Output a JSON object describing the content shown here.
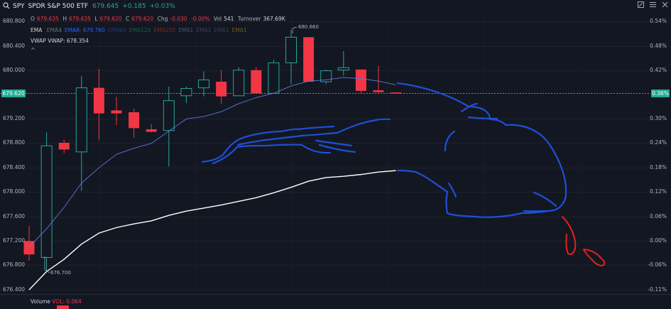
{
  "header": {
    "symbol": "SPY",
    "name": "SPDR S&P 500 ETF",
    "price": "679.645",
    "change": "+0.185",
    "change_pct": "+0.03%"
  },
  "ohlc": {
    "o_label": "O",
    "o": "679.635",
    "h_label": "H",
    "h": "679.635",
    "l_label": "L",
    "l": "679.620",
    "c_label": "C",
    "c": "679.620",
    "chg_label": "Chg",
    "chg": "-0.030",
    "chg_pct": "-0.00%",
    "vol_label": "Vol",
    "vol": "541",
    "turnover_label": "Turnover",
    "turnover": "367.69K"
  },
  "indicators": {
    "ema_title": "EMA",
    "ema_items": [
      {
        "label": "EMA4",
        "color": "#6b6f7a"
      },
      {
        "label": "EMA8: 679.760",
        "color": "#2962ff"
      },
      {
        "label": "EMA60",
        "color": "#1e3a6e"
      },
      {
        "label": "EMA120",
        "color": "#1b5e4c"
      },
      {
        "label": "EMA250",
        "color": "#6e2a2a"
      },
      {
        "label": "EMA1",
        "color": "#3d5566"
      },
      {
        "label": "EMA1",
        "color": "#3e3e55"
      },
      {
        "label": "EMA1",
        "color": "#3e3e55"
      },
      {
        "label": "EMA1",
        "color": "#6e5a1e"
      }
    ],
    "vwap_title": "VWAP",
    "vwap_value": "VWAP: 678.354",
    "collapse_glyph": "^"
  },
  "volume": {
    "title": "Volume",
    "value": "VOL: 0.064"
  },
  "price_axis": [
    "680.800",
    "680.400",
    "680.000",
    "679.620",
    "679.200",
    "678.800",
    "678.400",
    "678.000",
    "677.600",
    "677.200",
    "676.800",
    "676.400"
  ],
  "pct_axis": [
    "0.54%",
    "0.48%",
    "0.42%",
    "0.36%",
    "0.30%",
    "0.24%",
    "0.18%",
    "0.12%",
    "0.06%",
    "0.00%",
    "-0.06%",
    "-0.11%"
  ],
  "last_price_tag": "679.620",
  "last_pct_tag": "0.36%",
  "annotations": {
    "high": "680.660",
    "low": "676.700"
  },
  "colors": {
    "up": "#26a69a",
    "down": "#f23645",
    "background": "#131722",
    "ema8": "#2962ff",
    "vwap": "#ffffff",
    "drawing_blue": "#1e4fd8",
    "drawing_red": "#e8201d"
  },
  "icons": [
    "search-icon",
    "fullscreen-icon",
    "list-icon",
    "close-icon"
  ],
  "chart_data": {
    "type": "candlestick",
    "y_axis_range": [
      676.4,
      680.8
    ],
    "candles": [
      {
        "o": 677.2,
        "h": 677.45,
        "l": 676.88,
        "c": 676.98
      },
      {
        "o": 676.93,
        "h": 678.98,
        "l": 676.7,
        "c": 678.76
      },
      {
        "o": 678.81,
        "h": 678.86,
        "l": 678.64,
        "c": 678.7
      },
      {
        "o": 678.66,
        "h": 679.9,
        "l": 678.02,
        "c": 679.71
      },
      {
        "o": 679.71,
        "h": 680.02,
        "l": 678.85,
        "c": 679.29
      },
      {
        "o": 679.34,
        "h": 679.56,
        "l": 679.1,
        "c": 679.29
      },
      {
        "o": 679.31,
        "h": 679.37,
        "l": 678.89,
        "c": 679.05
      },
      {
        "o": 679.03,
        "h": 679.12,
        "l": 678.98,
        "c": 678.99
      },
      {
        "o": 679.01,
        "h": 679.73,
        "l": 678.42,
        "c": 679.5
      },
      {
        "o": 679.58,
        "h": 679.73,
        "l": 679.46,
        "c": 679.7
      },
      {
        "o": 679.71,
        "h": 679.98,
        "l": 679.57,
        "c": 679.84
      },
      {
        "o": 679.81,
        "h": 680.0,
        "l": 679.45,
        "c": 679.57
      },
      {
        "o": 679.58,
        "h": 680.05,
        "l": 679.58,
        "c": 680.0
      },
      {
        "o": 680.0,
        "h": 680.05,
        "l": 679.7,
        "c": 679.62
      },
      {
        "o": 679.62,
        "h": 680.17,
        "l": 679.62,
        "c": 680.12
      },
      {
        "o": 680.12,
        "h": 680.66,
        "l": 679.77,
        "c": 680.54
      },
      {
        "o": 680.54,
        "h": 680.54,
        "l": 679.81,
        "c": 679.81
      },
      {
        "o": 679.81,
        "h": 680.01,
        "l": 679.77,
        "c": 679.99
      },
      {
        "o": 680.0,
        "h": 680.31,
        "l": 679.91,
        "c": 680.04
      },
      {
        "o": 680.01,
        "h": 680.01,
        "l": 679.63,
        "c": 679.66
      },
      {
        "o": 679.67,
        "h": 680.07,
        "l": 679.62,
        "c": 679.64
      },
      {
        "o": 679.635,
        "h": 679.635,
        "l": 679.62,
        "c": 679.62
      }
    ],
    "vwap": [
      676.4,
      676.7,
      676.9,
      677.15,
      677.33,
      677.42,
      677.48,
      677.53,
      677.62,
      677.69,
      677.74,
      677.79,
      677.85,
      677.91,
      677.99,
      678.08,
      678.18,
      678.24,
      678.26,
      678.29,
      678.33,
      678.354
    ],
    "ema8": [
      677.1,
      677.4,
      677.75,
      678.15,
      678.4,
      678.62,
      678.72,
      678.8,
      679.0,
      679.2,
      679.24,
      679.32,
      679.45,
      679.55,
      679.62,
      679.74,
      679.82,
      679.84,
      679.88,
      679.86,
      679.82,
      679.76
    ]
  }
}
